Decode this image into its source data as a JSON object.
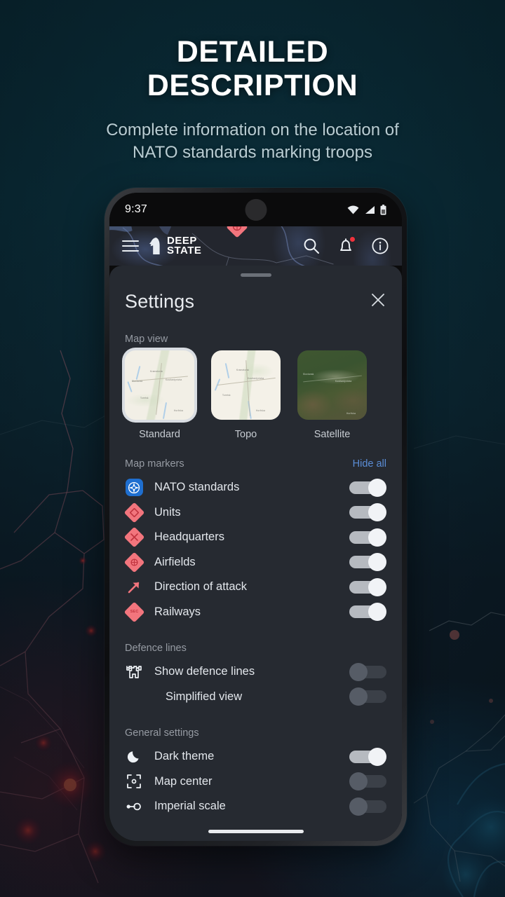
{
  "promo": {
    "headline_line1": "DETAILED",
    "headline_line2": "DESCRIPTION",
    "subhead_line1": "Complete information on the location of",
    "subhead_line2": "NATO standards marking troops"
  },
  "status_bar": {
    "time": "9:37",
    "icons": [
      "wifi-icon",
      "cellular-signal-icon",
      "battery-icon"
    ]
  },
  "app_header": {
    "menu_icon": "hamburger-menu-icon",
    "brand_line1": "DEEP",
    "brand_line2": "STATE",
    "logo_icon": "knight-chess-piece-logo",
    "actions": [
      {
        "name": "search-icon",
        "label": "Search"
      },
      {
        "name": "notifications-bell-icon",
        "label": "Notifications",
        "badge": true
      },
      {
        "name": "info-circle-icon",
        "label": "Info"
      }
    ]
  },
  "sheet": {
    "title": "Settings",
    "close_label": "×",
    "map_view": {
      "label": "Map view",
      "options": [
        {
          "label": "Standard",
          "selected": true
        },
        {
          "label": "Topo",
          "selected": false
        },
        {
          "label": "Satellite",
          "selected": false
        }
      ]
    },
    "map_markers": {
      "label": "Map markers",
      "action_label": "Hide all",
      "action_color": "#5b8dd6",
      "items": [
        {
          "label": "NATO standards",
          "icon": "nato-compass-icon",
          "on": true
        },
        {
          "label": "Units",
          "icon": "units-diamond-icon",
          "on": true
        },
        {
          "label": "Headquarters",
          "icon": "headquarters-diamond-icon",
          "on": true
        },
        {
          "label": "Airfields",
          "icon": "airfield-diamond-icon",
          "on": true
        },
        {
          "label": "Direction of attack",
          "icon": "arrow-up-right-icon",
          "on": true
        },
        {
          "label": "Railways",
          "icon": "railway-diamond-icon",
          "on": true
        }
      ]
    },
    "defence_lines": {
      "label": "Defence lines",
      "items": [
        {
          "label": "Show defence lines",
          "icon": "fortress-tower-icon",
          "on": false,
          "indented": false
        },
        {
          "label": "Simplified view",
          "icon": "none",
          "on": false,
          "indented": true
        }
      ]
    },
    "general_settings": {
      "label": "General settings",
      "items": [
        {
          "label": "Dark theme",
          "icon": "moon-icon",
          "on": true
        },
        {
          "label": "Map center",
          "icon": "map-center-target-icon",
          "on": false
        },
        {
          "label": "Imperial scale",
          "icon": "ruler-scale-icon",
          "on": false
        }
      ]
    }
  },
  "colors": {
    "background_deep": "#0a2b36",
    "sheet_bg": "#262a31",
    "accent_blue": "#5b8dd6",
    "marker_red": "#f2757d",
    "nato_blue": "#1f6fd0",
    "notification_red": "#f0323c"
  }
}
